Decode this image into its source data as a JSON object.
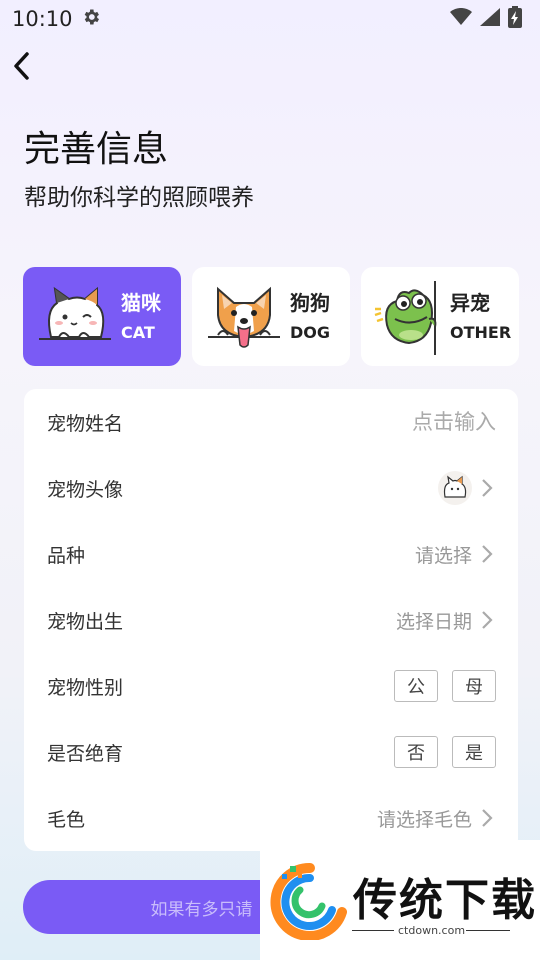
{
  "status": {
    "time": "10:10"
  },
  "header": {
    "title": "完善信息",
    "subtitle": "帮助你科学的照顾喂养"
  },
  "pet_types": [
    {
      "name": "猫咪",
      "en": "CAT",
      "selected": true
    },
    {
      "name": "狗狗",
      "en": "DOG",
      "selected": false
    },
    {
      "name": "异宠",
      "en": "OTHER",
      "selected": false
    }
  ],
  "form": {
    "pet_name": {
      "label": "宠物姓名",
      "placeholder": "点击输入"
    },
    "pet_avatar": {
      "label": "宠物头像"
    },
    "breed": {
      "label": "品种",
      "value": "请选择"
    },
    "birth": {
      "label": "宠物出生",
      "value": "选择日期"
    },
    "gender": {
      "label": "宠物性别",
      "options": [
        "公",
        "母"
      ]
    },
    "neutered": {
      "label": "是否绝育",
      "options": [
        "否",
        "是"
      ]
    },
    "coat": {
      "label": "毛色",
      "value": "请选择毛色"
    }
  },
  "submit": {
    "label": "如果有多只请"
  },
  "watermark": {
    "text": "传统下载",
    "url": "ctdown.com"
  },
  "colors": {
    "accent": "#7a5bf5",
    "background": "#f4f2fb"
  }
}
